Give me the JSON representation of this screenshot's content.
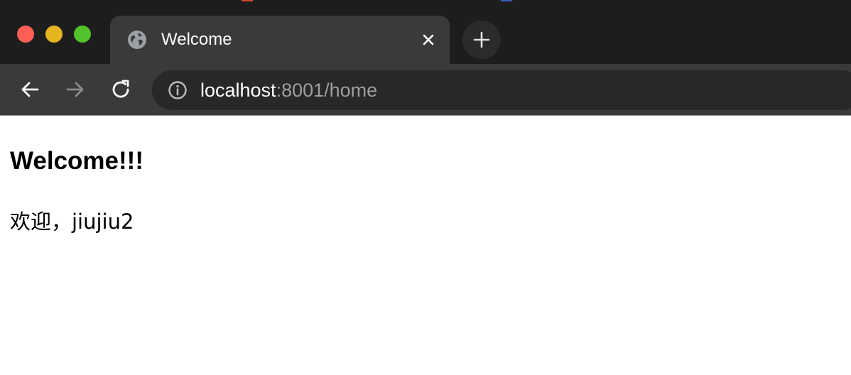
{
  "browser": {
    "background_tabs": [
      "",
      "",
      "",
      ""
    ],
    "active_tab": {
      "title": "Welcome",
      "icon": "globe-icon"
    },
    "new_tab_icon": "plus-icon",
    "nav": {
      "back": "arrow-left-icon",
      "forward": "arrow-right-icon",
      "reload": "reload-icon"
    },
    "address": {
      "host": "localhost",
      "rest": ":8001/home",
      "icon": "info-icon"
    },
    "traffic_lights": {
      "close": "#ff5f57",
      "minimize": "#e6b41f",
      "zoom": "#52c22c"
    }
  },
  "page": {
    "heading": "Welcome!!!",
    "greeting": "欢迎，jiujiu2"
  }
}
